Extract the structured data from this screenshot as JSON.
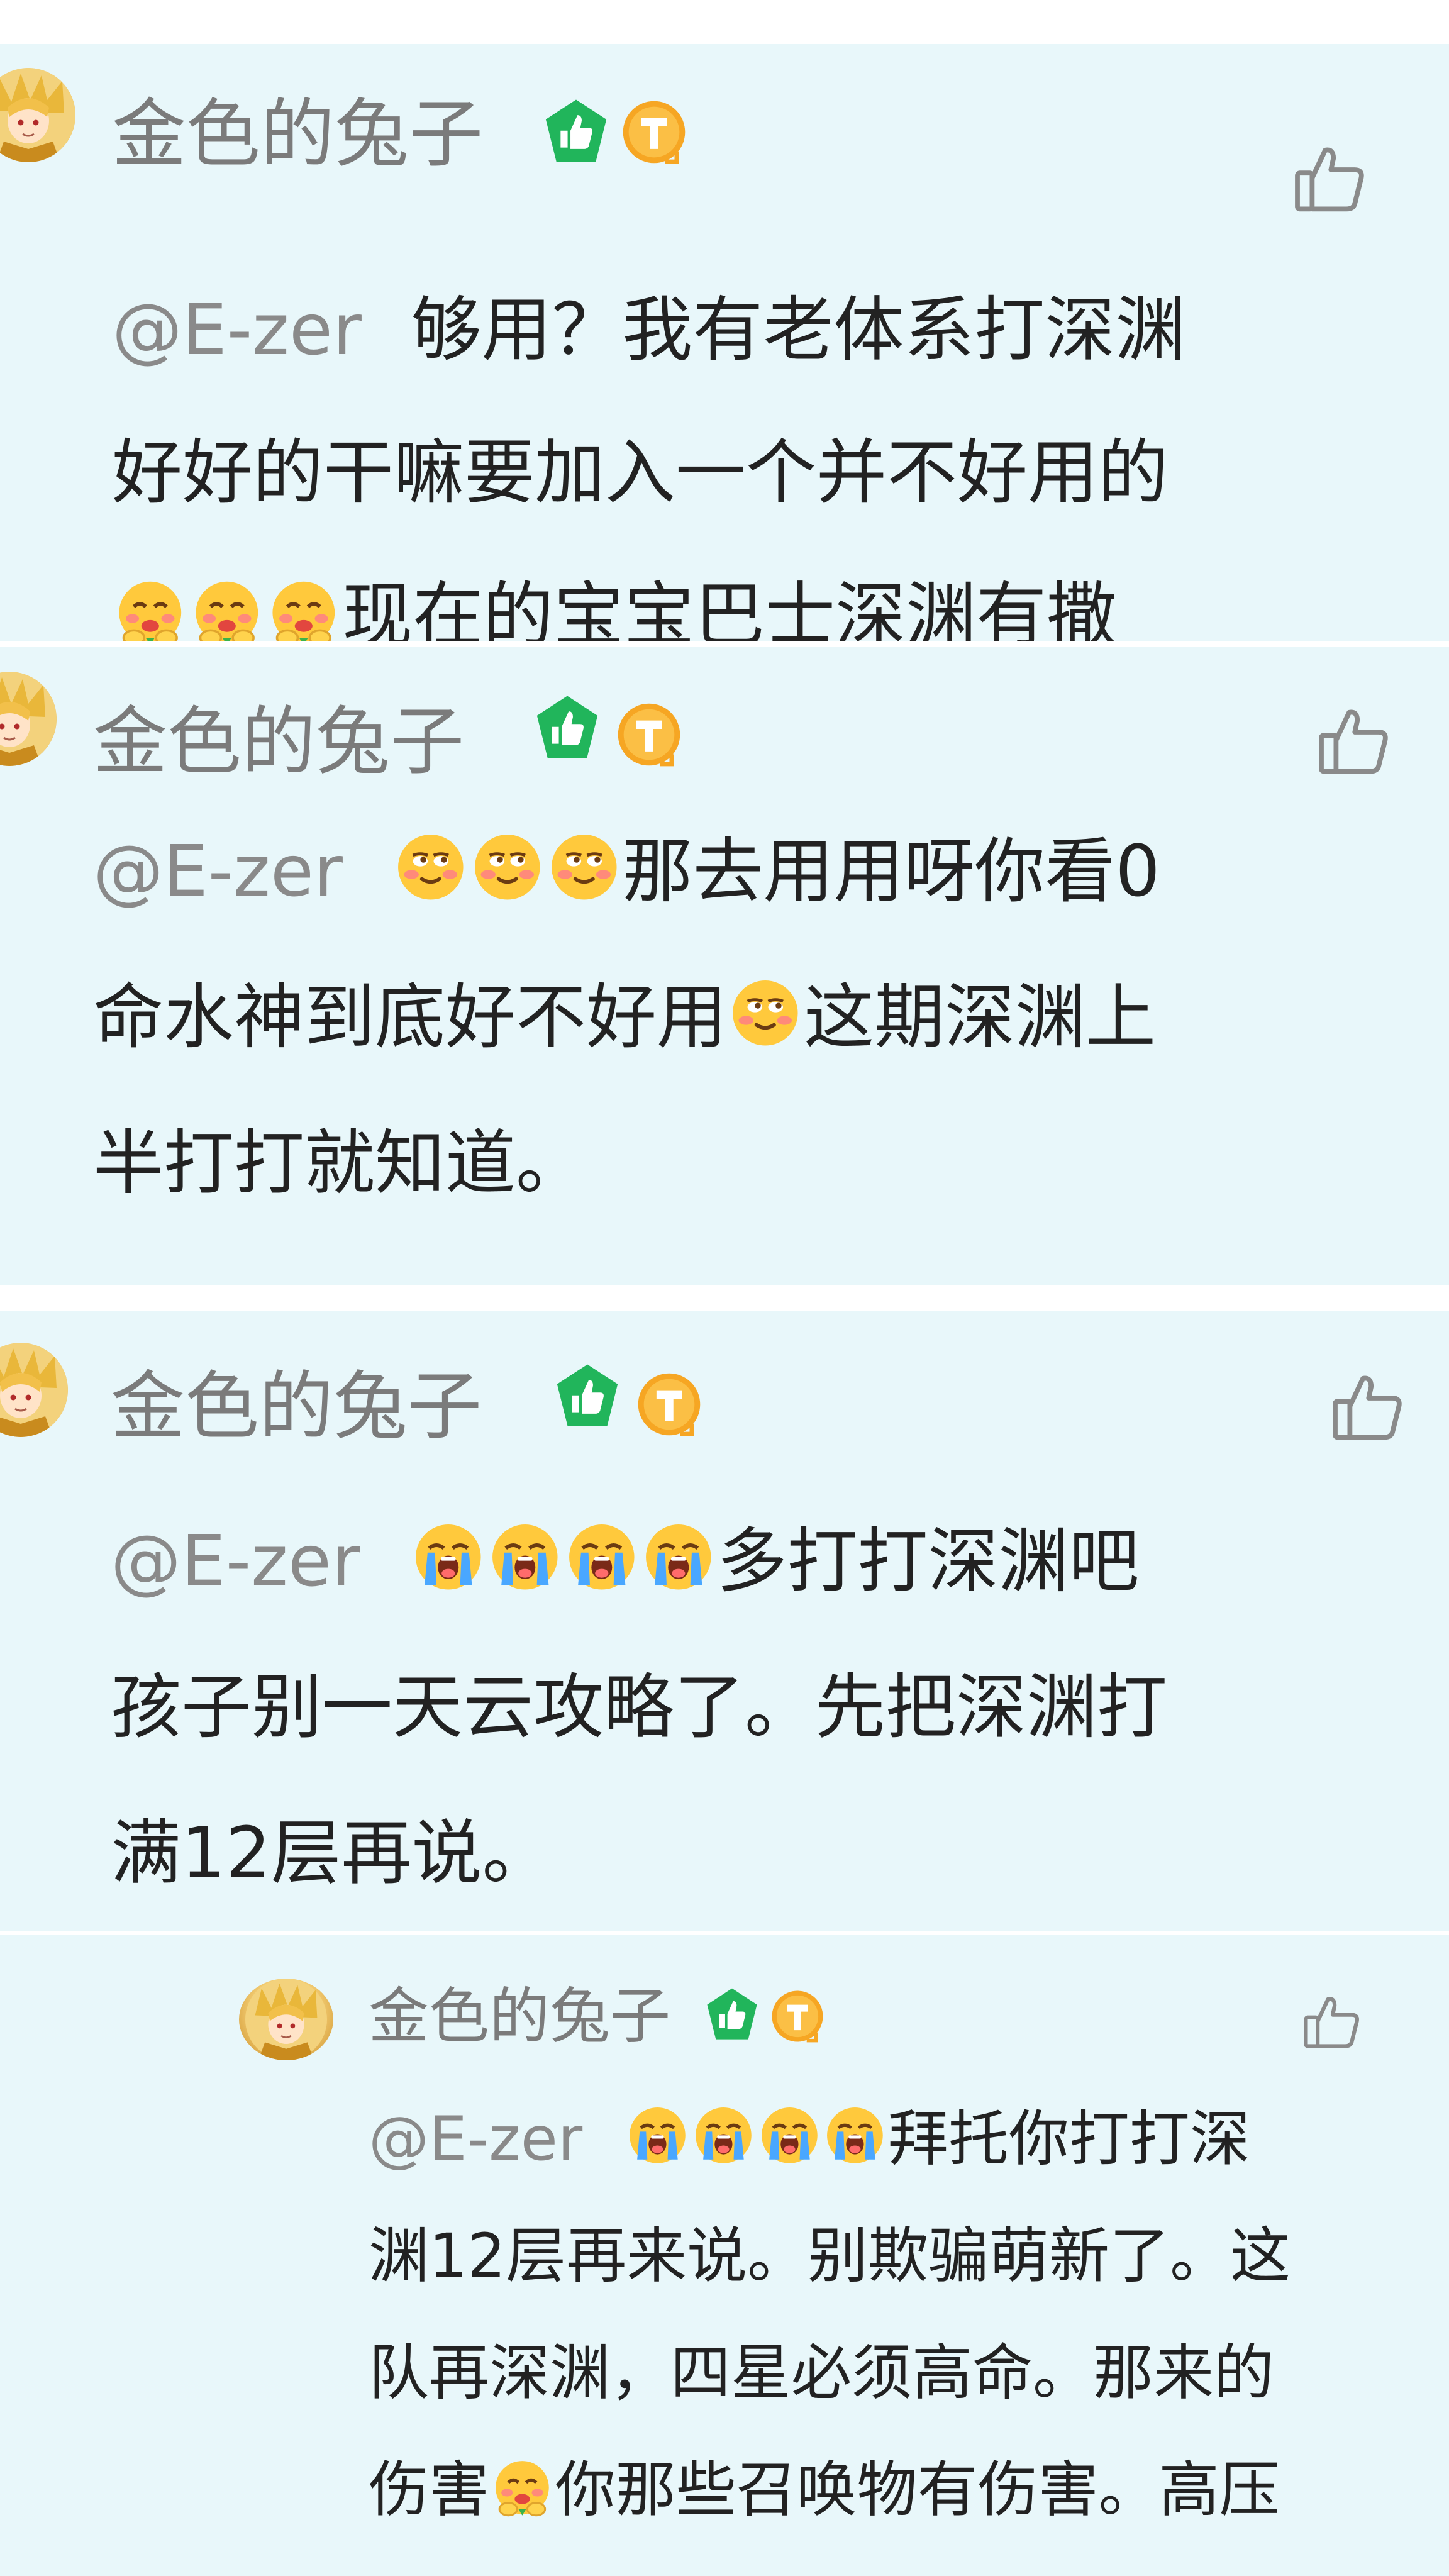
{
  "colors": {
    "card_bg": "#e8f7fa",
    "name": "#7b7b7b",
    "mention": "#8a8a8a",
    "text": "#222222",
    "level_badge": "#21b55b",
    "coin_badge": "#f6a623",
    "like_icon": "#8a8a8a"
  },
  "comments": [
    {
      "user": "金色的兔子",
      "mention": "@E-zer",
      "icons": [
        "avatar",
        "level-badge-icon",
        "coin-badge-icon",
        "thumbs-up-icon"
      ],
      "lines": [
        [
          {
            "t": "text",
            "v": "够用？我有老体系打深渊"
          }
        ],
        [
          {
            "t": "text",
            "v": "好好的干嘛要加入一个并不好用的"
          }
        ],
        [
          {
            "t": "emoji",
            "name": "drool-emoji"
          },
          {
            "t": "emoji",
            "name": "drool-emoji"
          },
          {
            "t": "emoji",
            "name": "drool-emoji"
          },
          {
            "t": "text",
            "v": "现在的宝宝巴士深渊有撒"
          }
        ]
      ]
    },
    {
      "user": "金色的兔子",
      "mention": "@E-zer",
      "icons": [
        "avatar",
        "level-badge-icon",
        "coin-badge-icon",
        "thumbs-up-icon"
      ],
      "lines": [
        [
          {
            "t": "emoji",
            "name": "smug-emoji"
          },
          {
            "t": "emoji",
            "name": "smug-emoji"
          },
          {
            "t": "emoji",
            "name": "smug-emoji"
          },
          {
            "t": "text",
            "v": "那去用用呀你看0"
          }
        ],
        [
          {
            "t": "text",
            "v": "命水神到底好不好用"
          },
          {
            "t": "emoji",
            "name": "smug-emoji"
          },
          {
            "t": "text",
            "v": "这期深渊上"
          }
        ],
        [
          {
            "t": "text",
            "v": "半打打就知道。"
          }
        ]
      ]
    },
    {
      "user": "金色的兔子",
      "mention": "@E-zer",
      "icons": [
        "avatar",
        "level-badge-icon",
        "coin-badge-icon",
        "thumbs-up-icon"
      ],
      "lines": [
        [
          {
            "t": "emoji",
            "name": "crying-emoji"
          },
          {
            "t": "emoji",
            "name": "crying-emoji"
          },
          {
            "t": "emoji",
            "name": "crying-emoji"
          },
          {
            "t": "emoji",
            "name": "crying-emoji"
          },
          {
            "t": "text",
            "v": "多打打深渊吧"
          }
        ],
        [
          {
            "t": "text",
            "v": "孩子别一天云攻略了。先把深渊打"
          }
        ],
        [
          {
            "t": "text",
            "v": "满12层再说。"
          }
        ]
      ]
    },
    {
      "user": "金色的兔子",
      "mention": "@E-zer",
      "icons": [
        "avatar",
        "level-badge-icon",
        "coin-badge-icon",
        "thumbs-up-icon"
      ],
      "lines": [
        [
          {
            "t": "emoji",
            "name": "crying-emoji"
          },
          {
            "t": "emoji",
            "name": "crying-emoji"
          },
          {
            "t": "emoji",
            "name": "crying-emoji"
          },
          {
            "t": "emoji",
            "name": "crying-emoji"
          },
          {
            "t": "text",
            "v": "拜托你打打深"
          }
        ],
        [
          {
            "t": "text",
            "v": "渊12层再来说。别欺骗萌新了。这"
          }
        ],
        [
          {
            "t": "text",
            "v": "队再深渊，四星必须高命。那来的"
          }
        ],
        [
          {
            "t": "text",
            "v": "伤害"
          },
          {
            "t": "emoji",
            "name": "drool-emoji"
          },
          {
            "t": "text",
            "v": "你那些召唤物有伤害。高压"
          }
        ]
      ]
    }
  ]
}
